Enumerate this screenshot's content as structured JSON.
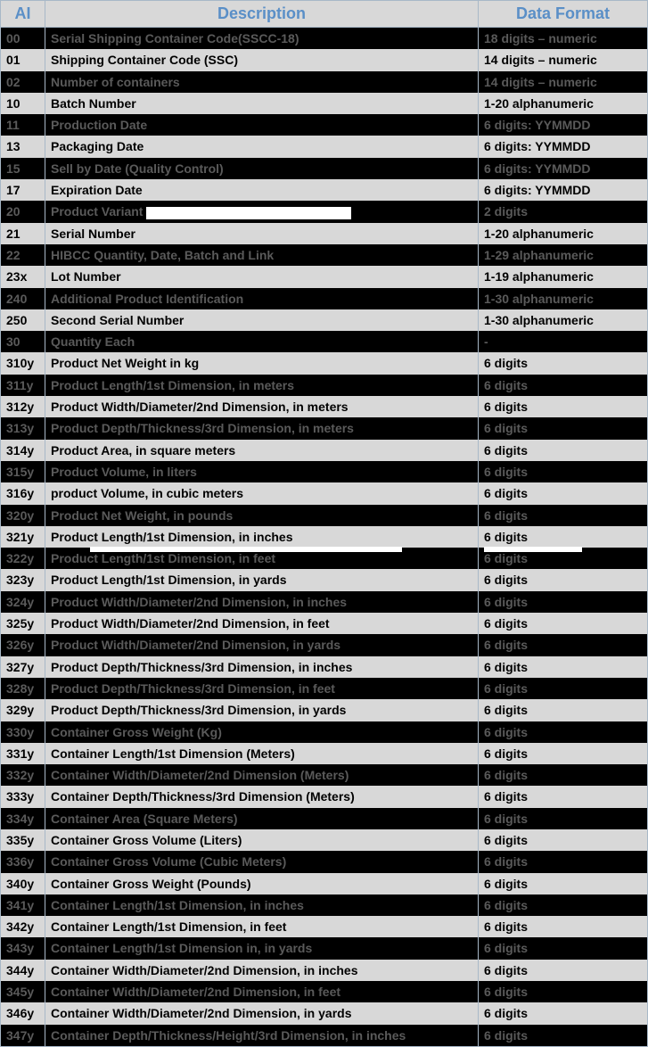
{
  "headers": {
    "ai": "AI",
    "desc": "Description",
    "fmt": "Data Format"
  },
  "rows": [
    {
      "ai": "00",
      "desc": "Serial Shipping Container Code(SSCC-18)",
      "fmt": "18 digits – numeric",
      "style": "dark"
    },
    {
      "ai": "01",
      "desc": "Shipping Container Code (SSC)",
      "fmt": "14 digits – numeric",
      "style": "light"
    },
    {
      "ai": "02",
      "desc": "Number of containers",
      "fmt": "14 digits – numeric",
      "style": "dark"
    },
    {
      "ai": "10",
      "desc": "Batch Number",
      "fmt": "1-20 alphanumeric",
      "style": "light"
    },
    {
      "ai": "11",
      "desc": "Production Date",
      "fmt": "6 digits: YYMMDD",
      "style": "dark"
    },
    {
      "ai": "13",
      "desc": "Packaging Date",
      "fmt": "6 digits: YYMMDD",
      "style": "light"
    },
    {
      "ai": "15",
      "desc": "Sell by Date (Quality Control)",
      "fmt": "6 digits: YYMMDD",
      "style": "dark"
    },
    {
      "ai": "17",
      "desc": "Expiration Date",
      "fmt": "6 digits: YYMMDD",
      "style": "light"
    },
    {
      "ai": "20",
      "desc": "Product Variant",
      "fmt": "2 digits",
      "style": "dark",
      "white_after_desc": 230
    },
    {
      "ai": "21",
      "desc": "Serial Number",
      "fmt": "1-20 alphanumeric",
      "style": "light"
    },
    {
      "ai": "22",
      "desc": "HIBCC Quantity, Date, Batch and Link",
      "fmt": "1-29 alphanumeric",
      "style": "dark"
    },
    {
      "ai": "23x",
      "desc": "Lot Number",
      "fmt": "1-19 alphanumeric",
      "style": "light"
    },
    {
      "ai": "240",
      "desc": "Additional Product Identification",
      "fmt": "1-30 alphanumeric",
      "style": "dark"
    },
    {
      "ai": "250",
      "desc": "Second Serial Number",
      "fmt": "1-30 alphanumeric",
      "style": "light"
    },
    {
      "ai": "30",
      "desc": "Quantity Each",
      "fmt": "-",
      "style": "dark"
    },
    {
      "ai": "310y",
      "desc": "Product Net Weight in kg",
      "fmt": "6 digits",
      "style": "light"
    },
    {
      "ai": "311y",
      "desc": "Product Length/1st Dimension, in meters",
      "fmt": "6 digits",
      "style": "dark"
    },
    {
      "ai": "312y",
      "desc": "Product Width/Diameter/2nd Dimension, in meters",
      "fmt": "6 digits",
      "style": "light"
    },
    {
      "ai": "313y",
      "desc": "Product Depth/Thickness/3rd Dimension, in meters",
      "fmt": "6 digits",
      "style": "dark"
    },
    {
      "ai": "314y",
      "desc": "Product Area, in square meters",
      "fmt": "6 digits",
      "style": "light"
    },
    {
      "ai": "315y",
      "desc": "Product Volume, in liters",
      "fmt": "6 digits",
      "style": "dark"
    },
    {
      "ai": "316y",
      "desc": "product Volume, in cubic meters",
      "fmt": "6 digits",
      "style": "light"
    },
    {
      "ai": "320y",
      "desc": "Product Net Weight, in pounds",
      "fmt": "6 digits",
      "style": "dark"
    },
    {
      "ai": "321y",
      "desc": "Product Length/1st Dimension, in inches",
      "fmt": "6 digits",
      "style": "light",
      "white_under_desc": 350,
      "white_under_fmt": 110
    },
    {
      "ai": "322y",
      "desc": "Product Length/1st Dimension, in feet",
      "fmt": "6 digits",
      "style": "dark"
    },
    {
      "ai": "323y",
      "desc": "Product Length/1st Dimension, in yards",
      "fmt": "6 digits",
      "style": "light"
    },
    {
      "ai": "324y",
      "desc": "Product Width/Diameter/2nd Dimension, in inches",
      "fmt": "6 digits",
      "style": "dark"
    },
    {
      "ai": "325y",
      "desc": "Product Width/Diameter/2nd Dimension, in feet",
      "fmt": "6 digits",
      "style": "light"
    },
    {
      "ai": "326y",
      "desc": "Product Width/Diameter/2nd Dimension, in yards",
      "fmt": "6 digits",
      "style": "dark"
    },
    {
      "ai": "327y",
      "desc": "Product Depth/Thickness/3rd Dimension, in inches",
      "fmt": "6 digits",
      "style": "light"
    },
    {
      "ai": "328y",
      "desc": "Product Depth/Thickness/3rd Dimension, in feet",
      "fmt": "6 digits",
      "style": "dark"
    },
    {
      "ai": "329y",
      "desc": "Product Depth/Thickness/3rd Dimension, in yards",
      "fmt": "6 digits",
      "style": "light"
    },
    {
      "ai": "330y",
      "desc": "Container Gross Weight (Kg)",
      "fmt": "6 digits",
      "style": "dark"
    },
    {
      "ai": "331y",
      "desc": "Container Length/1st Dimension (Meters)",
      "fmt": "6 digits",
      "style": "light"
    },
    {
      "ai": "332y",
      "desc": "Container Width/Diameter/2nd Dimension (Meters)",
      "fmt": "6 digits",
      "style": "dark"
    },
    {
      "ai": "333y",
      "desc": "Container Depth/Thickness/3rd Dimension (Meters)",
      "fmt": "6 digits",
      "style": "light"
    },
    {
      "ai": "334y",
      "desc": "Container Area (Square Meters)",
      "fmt": "6 digits",
      "style": "dark"
    },
    {
      "ai": "335y",
      "desc": "Container Gross Volume (Liters)",
      "fmt": "6 digits",
      "style": "light"
    },
    {
      "ai": "336y",
      "desc": "Container Gross Volume (Cubic Meters)",
      "fmt": "6 digits",
      "style": "dark"
    },
    {
      "ai": "340y",
      "desc": "Container Gross Weight (Pounds)",
      "fmt": "6 digits",
      "style": "light"
    },
    {
      "ai": "341y",
      "desc": "Container Length/1st Dimension, in inches",
      "fmt": "6 digits",
      "style": "dark"
    },
    {
      "ai": "342y",
      "desc": "Container Length/1st Dimension, in feet",
      "fmt": "6 digits",
      "style": "light"
    },
    {
      "ai": "343y",
      "desc": "Container Length/1st Dimension in, in yards",
      "fmt": "6 digits",
      "style": "dark"
    },
    {
      "ai": "344y",
      "desc": "Container Width/Diameter/2nd Dimension, in inches",
      "fmt": "6 digits",
      "style": "light"
    },
    {
      "ai": "345y",
      "desc": "Container Width/Diameter/2nd Dimension, in feet",
      "fmt": "6 digits",
      "style": "dark"
    },
    {
      "ai": "346y",
      "desc": "Container Width/Diameter/2nd Dimension, in yards",
      "fmt": "6 digits",
      "style": "light"
    },
    {
      "ai": "347y",
      "desc": "Container Depth/Thickness/Height/3rd Dimension, in inches",
      "fmt": "6 digits",
      "style": "dark"
    }
  ]
}
